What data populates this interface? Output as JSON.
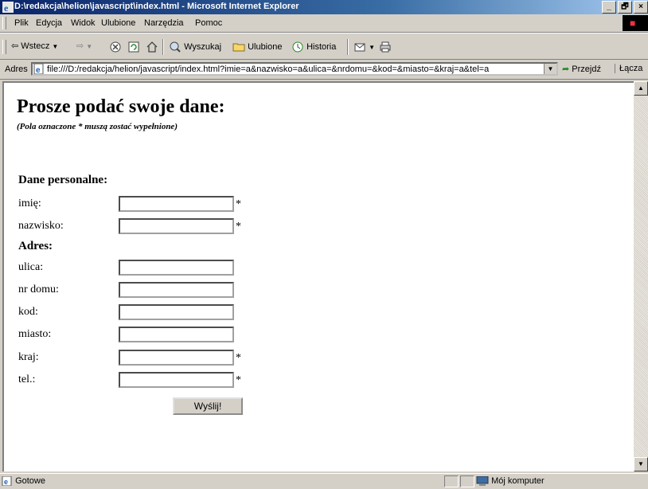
{
  "window": {
    "title": "D:\\redakcja\\helion\\javascript\\index.html - Microsoft Internet Explorer",
    "buttons": [
      "_",
      "🗗",
      "×"
    ]
  },
  "menu": [
    "Plik",
    "Edycja",
    "Widok",
    "Ulubione",
    "Narzędzia",
    "Pomoc"
  ],
  "toolbar": {
    "back": "Wstecz",
    "search": "Wyszukaj",
    "favorites": "Ulubione",
    "history": "Historia"
  },
  "address": {
    "label": "Adres",
    "url": "file:///D:/redakcja/helion/javascript/index.html?imie=a&nazwisko=a&ulica=&nrdomu=&kod=&miasto=&kraj=a&tel=a",
    "go": "Przejdź",
    "links": "Łącza"
  },
  "page": {
    "heading": "Prosze podać swoje dane:",
    "note": "(Pola oznaczone * muszą zostać wypełnione)",
    "personal_heading": "Dane personalne:",
    "address_heading": "Adres:",
    "required_mark": "*",
    "fields": {
      "imie": {
        "label": "imię:",
        "value": ""
      },
      "nazwisko": {
        "label": "nazwisko:",
        "value": ""
      },
      "ulica": {
        "label": "ulica:",
        "value": ""
      },
      "nr_domu": {
        "label": "nr domu:",
        "value": ""
      },
      "kod": {
        "label": "kod:",
        "value": ""
      },
      "miasto": {
        "label": "miasto:",
        "value": ""
      },
      "kraj": {
        "label": "kraj:",
        "value": ""
      },
      "tel": {
        "label": "tel.:",
        "value": ""
      }
    },
    "submit": "Wyślij!"
  },
  "status": {
    "text": "Gotowe",
    "zone": "Mój komputer"
  }
}
